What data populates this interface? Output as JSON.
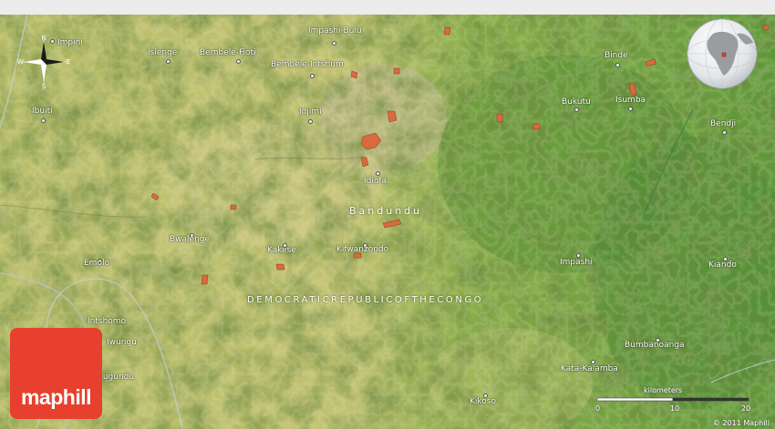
{
  "map": {
    "region_label": "Bandundu",
    "country_label": "DEMOCRATICREPUBLICOFTHECONGO",
    "places": [
      {
        "name": "Impashi-Bulu"
      },
      {
        "name": "Impini"
      },
      {
        "name": "Isienge"
      },
      {
        "name": "Bembele-Fioti"
      },
      {
        "name": "Bembele-Intshum"
      },
      {
        "name": "Binde"
      },
      {
        "name": "Ibuiti"
      },
      {
        "name": "Idjimi"
      },
      {
        "name": "Bukutu"
      },
      {
        "name": "Isumba"
      },
      {
        "name": "Bendji"
      },
      {
        "name": "Idiofa"
      },
      {
        "name": "Bwalenge"
      },
      {
        "name": "Kakese"
      },
      {
        "name": "Kifwanzondo"
      },
      {
        "name": "Emolo"
      },
      {
        "name": "Impashi"
      },
      {
        "name": "Kiando"
      },
      {
        "name": "Intshomo"
      },
      {
        "name": "Iwungu"
      },
      {
        "name": "Lugundu"
      },
      {
        "name": "Bumbanoanga"
      },
      {
        "name": "Kata-Kalamba"
      },
      {
        "name": "Kikoso"
      }
    ]
  },
  "compass": {
    "n": "N",
    "s": "S",
    "e": "E",
    "w": "W"
  },
  "scale": {
    "title": "kilometers",
    "start": "0",
    "mid": "10",
    "end": "20"
  },
  "branding": {
    "logo_text": "maphill",
    "copyright": "© 2011 Maphill"
  },
  "colors": {
    "logo": "#e8402e",
    "terrain_light": "#c8c874",
    "terrain_dark": "#4e8a30",
    "town": "#d96a3c"
  }
}
